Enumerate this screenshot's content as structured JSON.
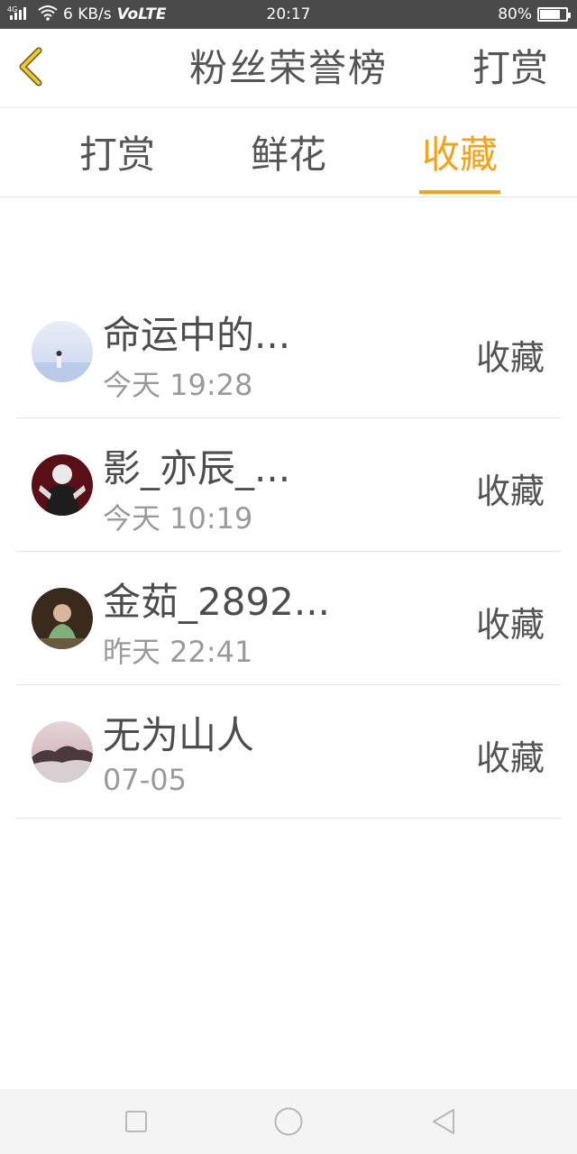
{
  "status_bar": {
    "network": "4G",
    "speed": "6 KB/s",
    "volte": "VoLTE",
    "time": "20:17",
    "battery_text": "80%",
    "battery_level": 0.8
  },
  "header": {
    "title": "粉丝荣誉榜",
    "action_label": "打赏",
    "accent_color": "#f5a21b"
  },
  "tabs": [
    {
      "label": "打赏",
      "active": false
    },
    {
      "label": "鲜花",
      "active": false
    },
    {
      "label": "收藏",
      "active": true
    }
  ],
  "list": [
    {
      "name": "命运中的...",
      "time": "今天 19:28",
      "action": "收藏",
      "avatar": "avatar-icon"
    },
    {
      "name": "影_亦辰_...",
      "time": "今天 10:19",
      "action": "收藏",
      "avatar": "avatar-icon"
    },
    {
      "name": "金茹_2892...",
      "time": "昨天 22:41",
      "action": "收藏",
      "avatar": "avatar-icon"
    },
    {
      "name": "无为山人",
      "time": "07-05",
      "action": "收藏",
      "avatar": "avatar-icon"
    }
  ]
}
